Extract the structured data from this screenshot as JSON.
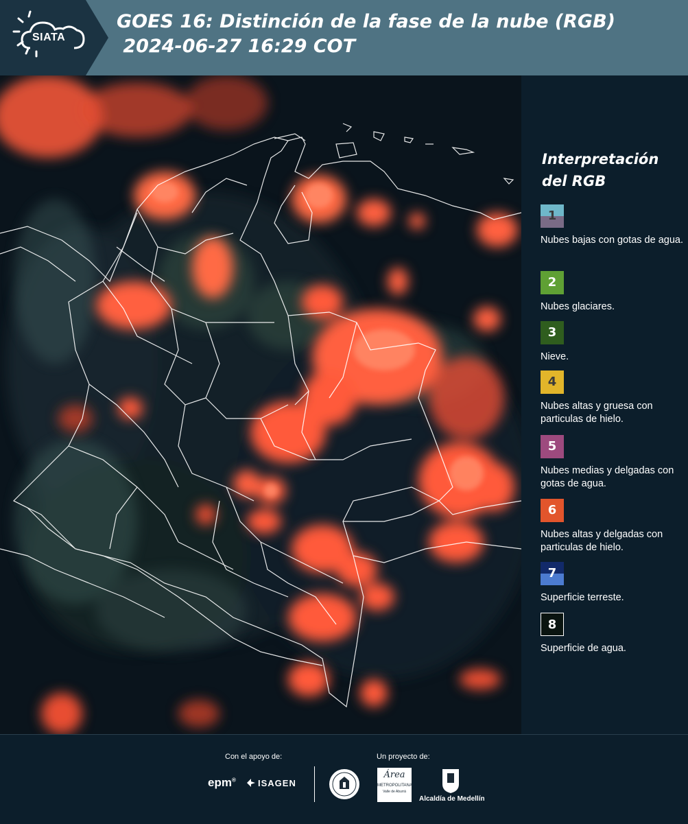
{
  "header": {
    "logo_text": "SIATA",
    "title_line1": "GOES 16: Distinción de la fase de la nube (RGB)",
    "title_line2": " 2024-06-27 16:29 COT",
    "background_color": "#4f7383",
    "logo_panel_color": "#1b3342"
  },
  "map": {
    "description_icon": "satellite-composite-image",
    "cloud_color": "#ff5a3a",
    "background_color": "#09141c",
    "boundary_color": "#ffffff"
  },
  "legend": {
    "title": "Interpretación del RGB",
    "items": [
      {
        "number": "1",
        "label": "Nubes bajas con gotas de agua.",
        "color_top": "#6fb7c9",
        "color_bottom": "#7a6b86",
        "text_color": "#3a3a3a"
      },
      {
        "number": "2",
        "label": "Nubes glaciares.",
        "color_top": "#5fa034",
        "color_bottom": "#5fa034",
        "text_color": "#ffffff"
      },
      {
        "number": "3",
        "label": "Nieve.",
        "color_top": "#2f5d1e",
        "color_bottom": "#2f5d1e",
        "text_color": "#ffffff"
      },
      {
        "number": "4",
        "label": "Nubes altas y gruesa con particulas de hielo.",
        "color_top": "#e2b52a",
        "color_bottom": "#e2b52a",
        "text_color": "#3a3a3a"
      },
      {
        "number": "5",
        "label": "Nubes medias y delgadas con gotas de agua.",
        "color_top": "#9d4a7e",
        "color_bottom": "#9d4a7e",
        "text_color": "#ffffff"
      },
      {
        "number": "6",
        "label": "Nubes altas y delgadas con particulas de hielo.",
        "color_top": "#e2552c",
        "color_bottom": "#e2552c",
        "text_color": "#ffffff"
      },
      {
        "number": "7",
        "label": "Superficie terreste.",
        "color_top": "#122a6a",
        "color_bottom": "#4c7bd0",
        "text_color": "#ffffff"
      },
      {
        "number": "8",
        "label": "Superficie de agua.",
        "color_top": "#0a1410",
        "color_bottom": "#0a1410",
        "text_color": "#ffffff"
      }
    ]
  },
  "footer": {
    "support_label": "Con el apoyo de:",
    "project_label": "Un proyecto de:",
    "sponsors": {
      "epm": "epm",
      "epm_mark": "®",
      "isagen": "ISAGEN",
      "area_title": "Área",
      "area_subtitle": "METROPOLITANA",
      "area_subtitle2": "Valle de Aburrá",
      "alcaldia": "Alcaldía de Medellín"
    }
  }
}
